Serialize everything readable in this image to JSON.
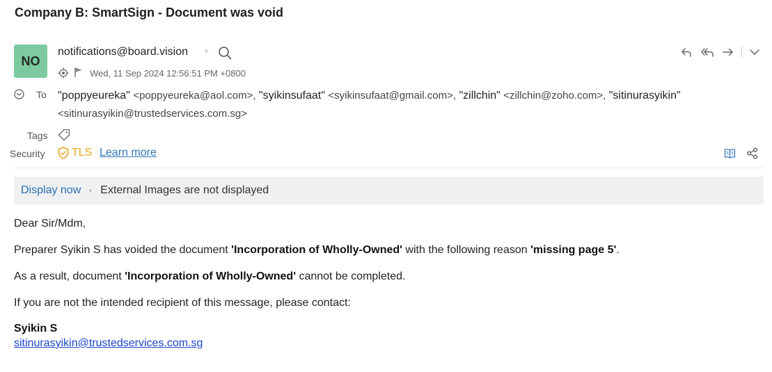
{
  "subject": "Company B: SmartSign - Document was void",
  "sender": {
    "initials": "NO",
    "avatar_color": "#7dcaa0",
    "email": "notifications@board.vision",
    "date": "Wed, 11 Sep 2024 12:56:51 PM +0800"
  },
  "to": {
    "label": "To",
    "recipients": [
      {
        "name": "\"poppyeureka\"",
        "email": "<poppyeureka@aol.com>,"
      },
      {
        "name": "\"syikinsufaat\"",
        "email": "<syikinsufaat@gmail.com>,"
      },
      {
        "name": "\"zillchin\"",
        "email": "<zillchin@zoho.com>,"
      },
      {
        "name": "\"sitinurasyikin\"",
        "email": "<sitinurasyikin@trustedservices.com.sg>"
      }
    ]
  },
  "tags": {
    "label": "Tags"
  },
  "security": {
    "label": "Security",
    "tls": "TLS",
    "learn_more": "Learn more",
    "tls_color": "#e8a51b"
  },
  "banner": {
    "display_now": "Display now",
    "message": "External Images are not displayed"
  },
  "body": {
    "greeting": "Dear Sir/Mdm,",
    "line1_pre": "Preparer Syikin S has voided the document ",
    "line1_doc": "'Incorporation of Wholly-Owned'",
    "line1_mid": " with the following reason ",
    "line1_reason": "'missing page 5'",
    "line1_end": ".",
    "line2_pre": "As a result, document ",
    "line2_doc": "'Incorporation of Wholly-Owned'",
    "line2_end": " cannot be completed.",
    "line3": "If you are not the intended recipient of this message, please contact:",
    "sig_name": "Syikin S",
    "sig_email": "sitinurasyikin@trustedservices.com.sg"
  },
  "icons": {
    "search": "search-icon",
    "location": "locate-icon",
    "flag": "flag-icon",
    "reply": "reply-icon",
    "reply_all": "reply-all-icon",
    "forward": "forward-icon",
    "more": "chevron-down-icon",
    "expand": "chevron-circle-icon",
    "tag": "tag-icon",
    "shield": "shield-check-icon",
    "book": "reader-icon",
    "share": "share-icon"
  }
}
